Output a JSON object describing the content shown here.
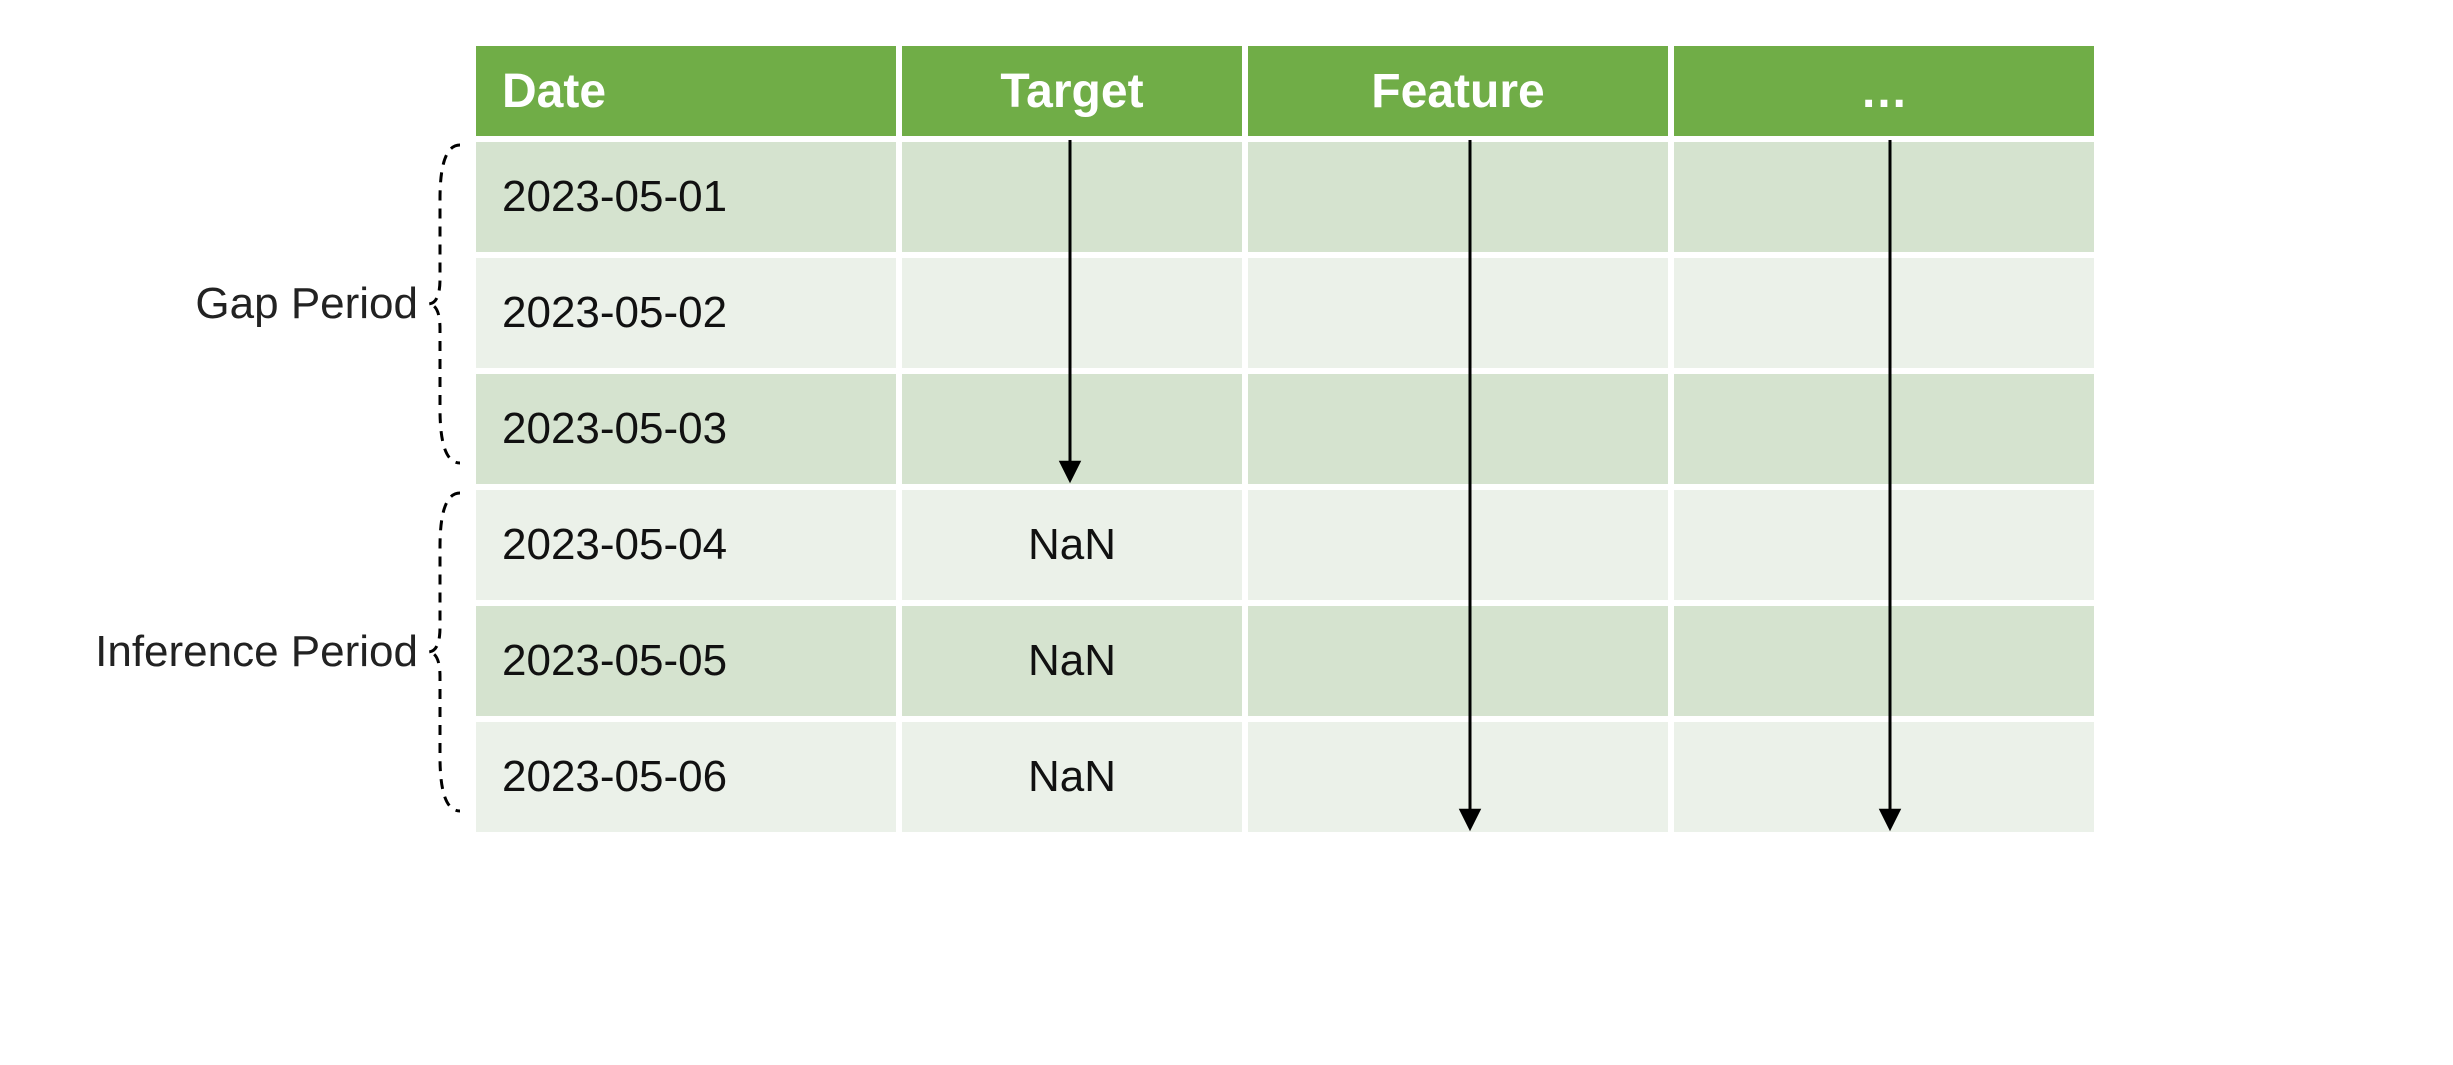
{
  "labels": {
    "gap": "Gap Period",
    "inference": "Inference Period"
  },
  "headers": {
    "date": "Date",
    "target": "Target",
    "feature": "Feature",
    "more": "…"
  },
  "rows": [
    {
      "date": "2023-05-01",
      "target": "",
      "feature": "",
      "more": ""
    },
    {
      "date": "2023-05-02",
      "target": "",
      "feature": "",
      "more": ""
    },
    {
      "date": "2023-05-03",
      "target": "",
      "feature": "",
      "more": ""
    },
    {
      "date": "2023-05-04",
      "target": "NaN",
      "feature": "",
      "more": ""
    },
    {
      "date": "2023-05-05",
      "target": "NaN",
      "feature": "",
      "more": ""
    },
    {
      "date": "2023-05-06",
      "target": "NaN",
      "feature": "",
      "more": ""
    }
  ],
  "periods": {
    "gap_rows": [
      0,
      1,
      2
    ],
    "inference_rows": [
      3,
      4,
      5
    ]
  },
  "arrows": {
    "target_spans_rows": 3,
    "feature_spans_rows": 6,
    "more_spans_rows": 6
  }
}
